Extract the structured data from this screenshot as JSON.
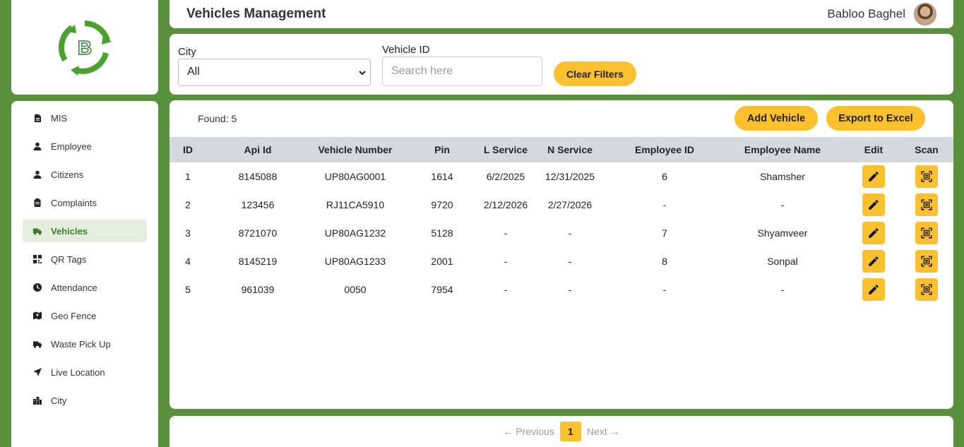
{
  "header": {
    "title": "Vehicles Management",
    "user_name": "Babloo Baghel"
  },
  "logo": {
    "letter": "B",
    "colors": [
      "#4aa02c",
      "#2e7d32"
    ]
  },
  "sidebar": {
    "items": [
      {
        "label": "MIS",
        "icon": "report-icon",
        "active": false
      },
      {
        "label": "Employee",
        "icon": "person-icon",
        "active": false
      },
      {
        "label": "Citizens",
        "icon": "person-icon",
        "active": false
      },
      {
        "label": "Complaints",
        "icon": "clipboard-icon",
        "active": false
      },
      {
        "label": "Vehicles",
        "icon": "truck-icon",
        "active": true
      },
      {
        "label": "QR Tags",
        "icon": "qr-icon",
        "active": false
      },
      {
        "label": "Attendance",
        "icon": "clock-icon",
        "active": false
      },
      {
        "label": "Geo Fence",
        "icon": "map-icon",
        "active": false
      },
      {
        "label": "Waste Pick Up",
        "icon": "truck-icon",
        "active": false
      },
      {
        "label": "Live Location",
        "icon": "navigation-icon",
        "active": false
      },
      {
        "label": "City",
        "icon": "city-icon",
        "active": false
      }
    ]
  },
  "filters": {
    "city_label": "City",
    "city_value": "All",
    "vehicle_id_label": "Vehicle ID",
    "vehicle_id_placeholder": "Search here",
    "clear_label": "Clear Filters"
  },
  "table": {
    "found_text": "Found: 5",
    "add_label": "Add Vehicle",
    "export_label": "Export to Excel",
    "columns": [
      "ID",
      "Api Id",
      "Vehicle Number",
      "Pin",
      "L Service",
      "N Service",
      "Employee ID",
      "Employee Name",
      "Edit",
      "Scan"
    ],
    "rows": [
      [
        "1",
        "8145088",
        "UP80AG0001",
        "1614",
        "6/2/2025",
        "12/31/2025",
        "6",
        "Shamsher"
      ],
      [
        "2",
        "123456",
        "RJ11CA5910",
        "9720",
        "2/12/2026",
        "2/27/2026",
        "-",
        "-"
      ],
      [
        "3",
        "8721070",
        "UP80AG1232",
        "5128",
        "-",
        "-",
        "7",
        "Shyamveer"
      ],
      [
        "4",
        "8145219",
        "UP80AG1233",
        "2001",
        "-",
        "-",
        "8",
        "Sonpal"
      ],
      [
        "5",
        "961039",
        "0050",
        "7954",
        "-",
        "-",
        "-",
        "-"
      ]
    ]
  },
  "pagination": {
    "previous": "← Previous",
    "current": "1",
    "next": "Next →"
  },
  "colors": {
    "background": "#5a8f3e",
    "accent": "#fbc02d",
    "active_nav": "#3d7b2c"
  }
}
